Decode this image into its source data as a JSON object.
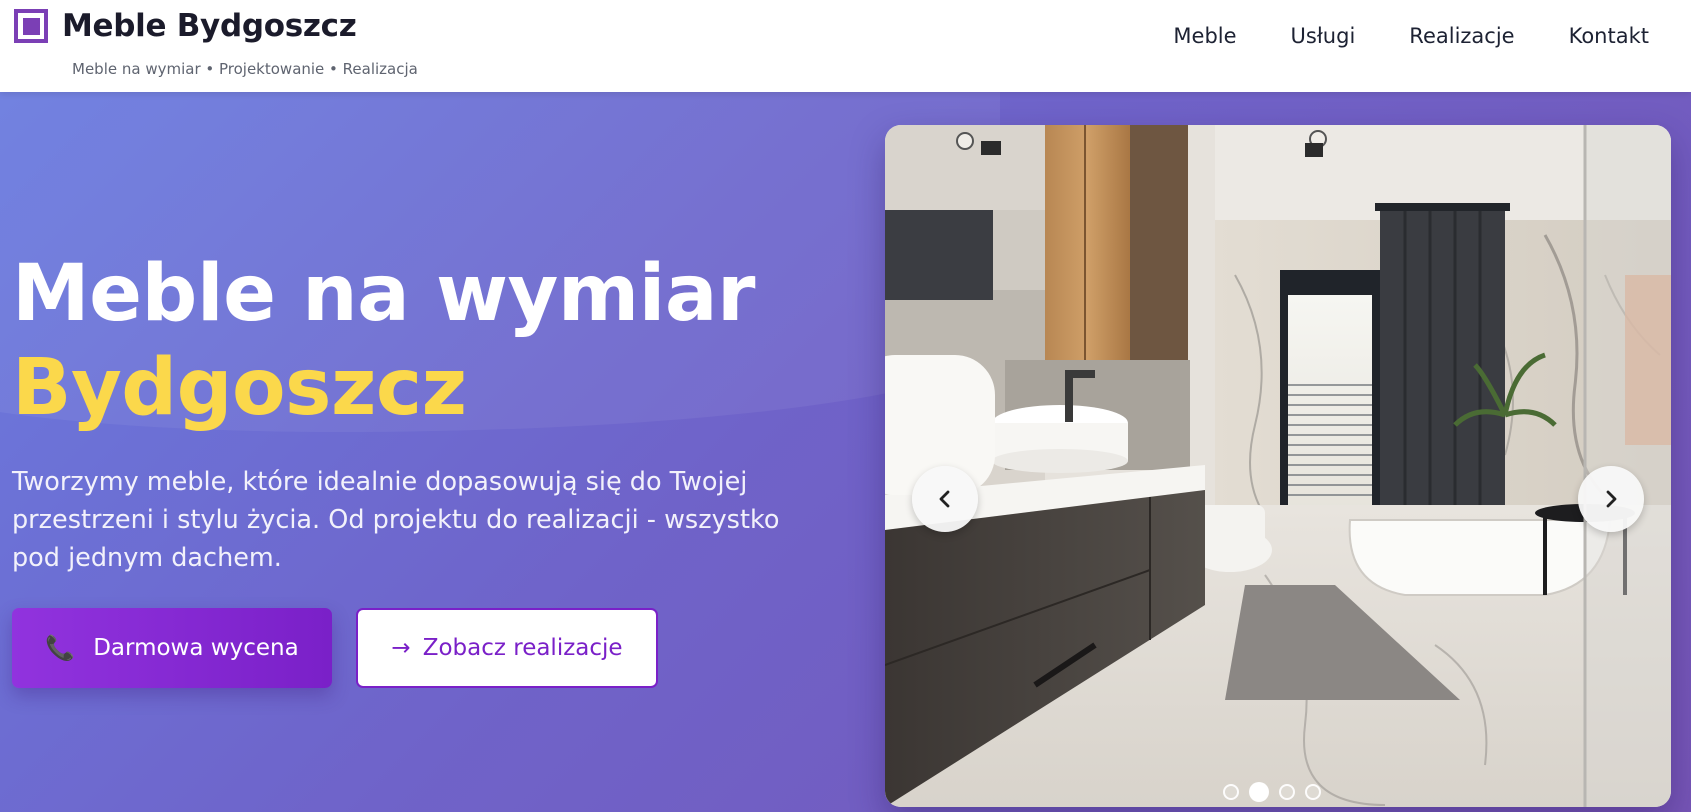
{
  "header": {
    "brand": "Meble Bydgoszcz",
    "tagline": "Meble na wymiar • Projektowanie • Realizacja",
    "logo_icon": "square-logo-icon",
    "nav": [
      {
        "label": "Meble"
      },
      {
        "label": "Usługi"
      },
      {
        "label": "Realizacje"
      },
      {
        "label": "Kontakt"
      }
    ]
  },
  "hero": {
    "title_line1": "Meble na wymiar",
    "title_line2": "Bydgoszcz",
    "description": "Tworzymy meble, które idealnie dopasowują się do Twojej przestrzeni i stylu życia. Od projektu do realizacji - wszystko pod jednym dachem.",
    "primary_button": {
      "icon": "📞",
      "label": "Darmowa wycena"
    },
    "secondary_button": {
      "icon": "→",
      "label": "Zobacz realizacje"
    }
  },
  "carousel": {
    "image_subject": "modern bathroom with marble walls, wooden cabinets and freestanding bathtub",
    "prev_icon": "chevron-left-icon",
    "next_icon": "chevron-right-icon",
    "slide_count": 4,
    "active_slide": 2
  },
  "colors": {
    "brand": "#7b3fb5",
    "accent_yellow": "#fbd84b",
    "button_purple": "#7a20c8",
    "hero_gradient_start": "#6a7bdf",
    "hero_gradient_end": "#7655b6"
  }
}
